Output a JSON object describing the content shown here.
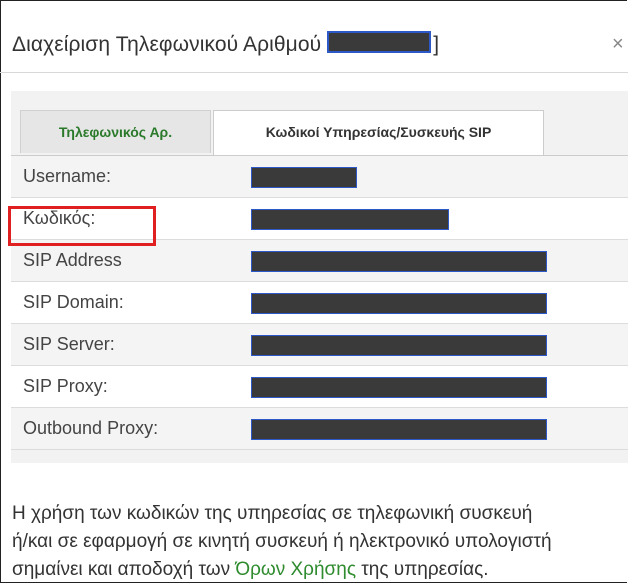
{
  "dialog": {
    "title": "Διαχείριση Τηλεφωνικού Αριθμού",
    "title_suffix": "]",
    "close_glyph": "×"
  },
  "tabs": [
    {
      "label": "Τηλεφωνικός Αρ.",
      "active": false
    },
    {
      "label": "Κωδικοί Υπηρεσίας/Συσκευής SIP",
      "active": true
    }
  ],
  "fields": [
    {
      "label": "Username:"
    },
    {
      "label": "Κωδικός:"
    },
    {
      "label": "SIP Address"
    },
    {
      "label": "SIP Domain:"
    },
    {
      "label": "SIP Server:"
    },
    {
      "label": "SIP Proxy:"
    },
    {
      "label": "Outbound Proxy:"
    }
  ],
  "footer": {
    "line1": "Η χρήση των κωδικών της υπηρεσίας σε τηλεφωνική συσκευή",
    "line2": "ή/και σε εφαρμογή σε κινητή συσκευή ή ηλεκτρονικό υπολογιστή",
    "line3_pre": "σημαίνει και αποδοχή των ",
    "link": "Όρων Χρήσης",
    "line3_post": " της υπηρεσίας."
  },
  "colors": {
    "active_tab_text": "#333333",
    "inactive_tab_text": "#2b7a2b",
    "link": "#2e8b2e",
    "highlight_border": "#e02020",
    "redaction": "#3a3a3a"
  }
}
